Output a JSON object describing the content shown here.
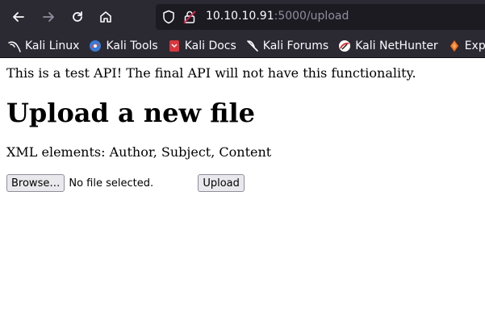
{
  "browser": {
    "url_host": "10.10.10.91",
    "url_rest": ":5000/upload",
    "bookmarks": [
      {
        "label": "Kali Linux",
        "icon": "kali-dragon-icon"
      },
      {
        "label": "Kali Tools",
        "icon": "kali-tools-icon"
      },
      {
        "label": "Kali Docs",
        "icon": "kali-docs-icon"
      },
      {
        "label": "Kali Forums",
        "icon": "kali-forums-icon"
      },
      {
        "label": "Kali NetHunter",
        "icon": "nethunter-icon"
      },
      {
        "label": "Exploit-",
        "icon": "exploit-db-icon"
      }
    ]
  },
  "page": {
    "notice": "This is a test API! The final API will not have this functionality.",
    "heading": "Upload a new file",
    "xml_elements": "XML elements: Author, Subject, Content",
    "browse_label": "Browse…",
    "file_status": "No file selected.",
    "upload_label": "Upload"
  }
}
